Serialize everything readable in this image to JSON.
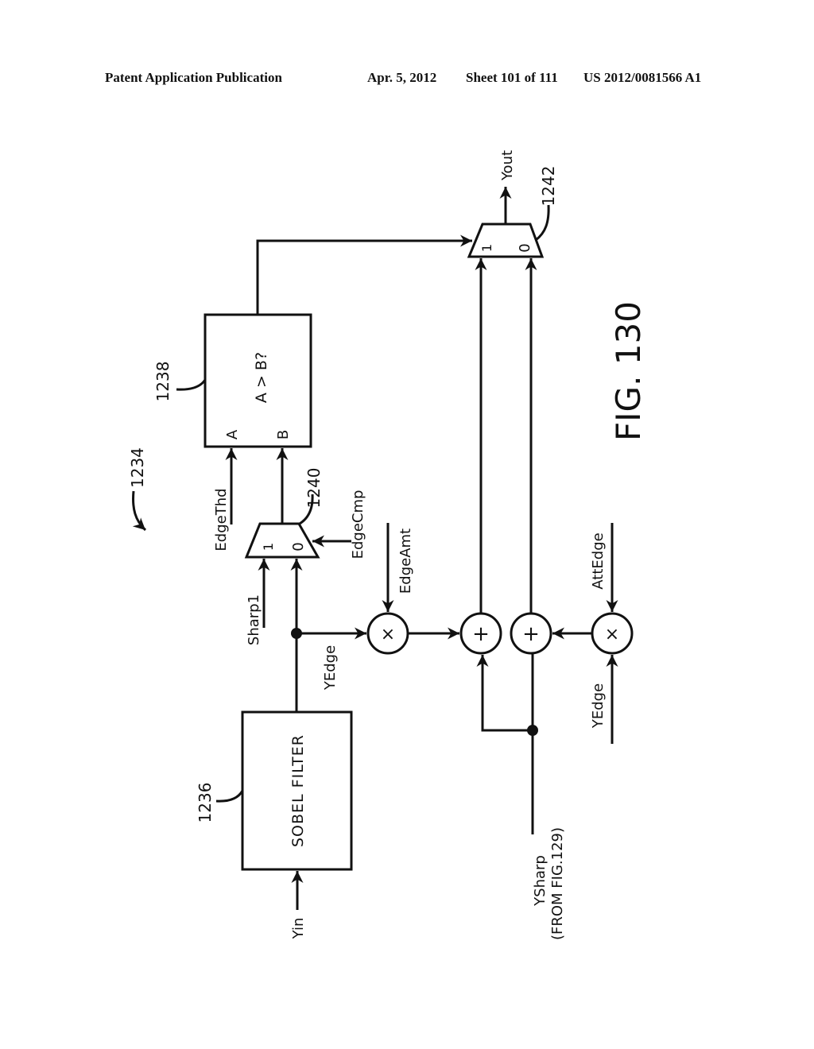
{
  "header": {
    "publication": "Patent Application Publication",
    "date": "Apr. 5, 2012",
    "sheet": "Sheet 101 of 111",
    "patent_number": "US 2012/0081566 A1"
  },
  "figure": {
    "label": "FIG. 130",
    "reference": "1234"
  },
  "blocks": {
    "sobel": {
      "ref": "1236",
      "label": "SOBEL FILTER"
    },
    "comparator": {
      "ref": "1238",
      "label": "A > B?",
      "input_a": "A",
      "input_b": "B"
    },
    "mux_edge": {
      "ref": "1240",
      "input_1": "1",
      "input_0": "0"
    },
    "mux_out": {
      "ref": "1242",
      "input_1": "1",
      "input_0": "0"
    },
    "mult1": {
      "symbol": "×"
    },
    "add1": {
      "symbol": "+"
    },
    "add2": {
      "symbol": "+"
    },
    "mult2": {
      "symbol": "×"
    }
  },
  "signals": {
    "yin": "Yin",
    "yout": "Yout",
    "edge_thd": "EdgeThd",
    "sharp1": "Sharp1",
    "edge_cmp": "EdgeCmp",
    "yedge1": "YEdge",
    "edge_amt": "EdgeAmt",
    "att_edge": "AttEdge",
    "yedge2": "YEdge",
    "ysharp": "YSharp",
    "ysharp_source": "(FROM  FIG.129)"
  }
}
